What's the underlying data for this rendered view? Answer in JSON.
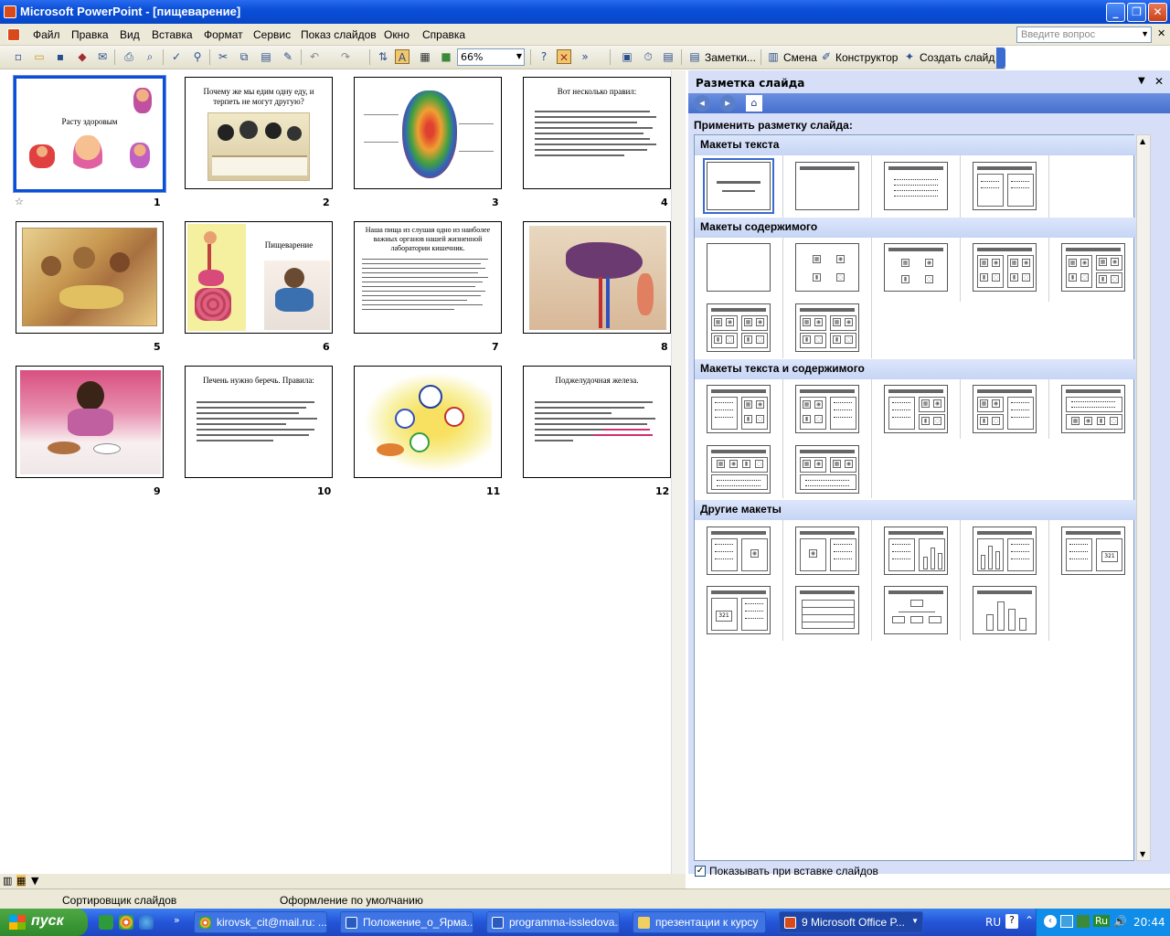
{
  "window": {
    "title": "Microsoft PowerPoint - [пищеварение]"
  },
  "menu": [
    "Файл",
    "Правка",
    "Вид",
    "Вставка",
    "Формат",
    "Сервис",
    "Показ слайдов",
    "Окно",
    "Справка"
  ],
  "help_search": {
    "placeholder": "Введите вопрос"
  },
  "toolbar": {
    "zoom": "66%",
    "notes": "Заметки...",
    "transition": "Смена",
    "designer": "Конструктор",
    "new_slide": "Создать слайд"
  },
  "slides": [
    {
      "num": "1",
      "title": "Расту здоровым"
    },
    {
      "num": "2",
      "title": "Почему же мы едим одну еду, и терпеть не могут другую?"
    },
    {
      "num": "3",
      "title": ""
    },
    {
      "num": "4",
      "title": "Вот несколько правил:"
    },
    {
      "num": "5",
      "title": ""
    },
    {
      "num": "6",
      "title": "Пищеварение"
    },
    {
      "num": "7",
      "title": "Наша пища из слушая одно из наиболее важных органов нашей жизненной лаборатории кишечник."
    },
    {
      "num": "8",
      "title": ""
    },
    {
      "num": "9",
      "title": ""
    },
    {
      "num": "10",
      "title": "Печень нужно беречь. Правила:"
    },
    {
      "num": "11",
      "title": ""
    },
    {
      "num": "12",
      "title": "Поджелудочная железа."
    }
  ],
  "task_pane": {
    "title": "Разметка слайда",
    "apply_label": "Применить разметку слайда:",
    "sections": [
      "Макеты текста",
      "Макеты содержимого",
      "Макеты текста и содержимого",
      "Другие макеты"
    ],
    "show_on_insert": "Показывать при вставке слайдов"
  },
  "status": {
    "view": "Сортировщик слайдов",
    "design": "Оформление по умолчанию"
  },
  "taskbar": {
    "start": "пуск",
    "tasks": [
      "kirovsk_cit@mail.ru: ...",
      "Положение_о_Ярма...",
      "programma-issledova...",
      "презентации к курсу",
      "9 Microsoft Office P..."
    ],
    "lang": "RU",
    "time": "20:44"
  }
}
